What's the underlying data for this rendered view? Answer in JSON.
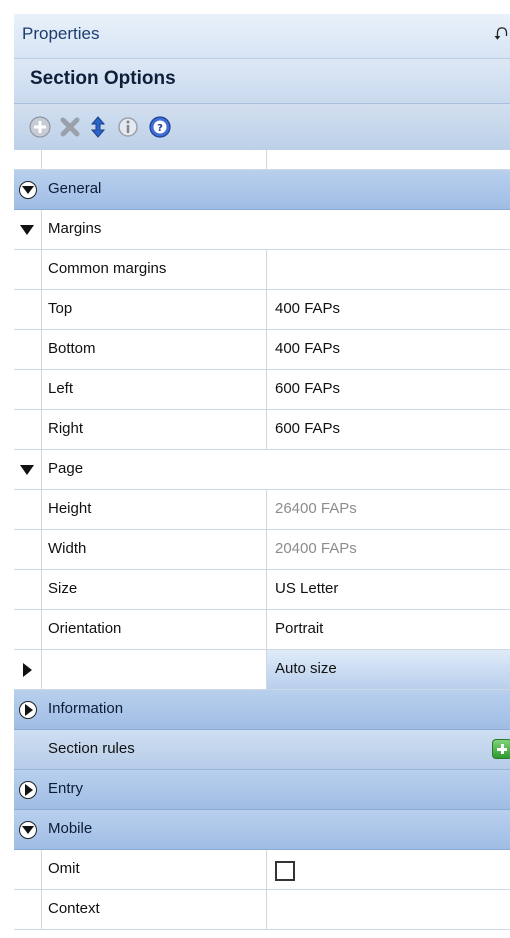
{
  "window": {
    "title": "Properties",
    "pin_glyph": "⮏"
  },
  "section": {
    "title": "Section Options"
  },
  "toolbar": {
    "buttons": [
      {
        "icon": "add-circle-icon"
      },
      {
        "icon": "delete-x-icon"
      },
      {
        "icon": "move-updown-icon"
      },
      {
        "icon": "info-icon"
      },
      {
        "icon": "help-icon"
      }
    ]
  },
  "grid": {
    "general": "General",
    "margins": "Margins",
    "common_margins": "Common margins",
    "top": {
      "label": "Top",
      "value": "400 FAPs"
    },
    "bottom": {
      "label": "Bottom",
      "value": "400 FAPs"
    },
    "left": {
      "label": "Left",
      "value": "600 FAPs"
    },
    "right": {
      "label": "Right",
      "value": "600 FAPs"
    },
    "page": "Page",
    "height": {
      "label": "Height",
      "value": "26400 FAPs"
    },
    "width": {
      "label": "Width",
      "value": "20400 FAPs"
    },
    "size": {
      "label": "Size",
      "value": "US Letter"
    },
    "orientation": {
      "label": "Orientation",
      "value": "Portrait"
    },
    "autosize": {
      "value": "Auto size"
    },
    "information": "Information",
    "section_rules": "Section rules",
    "entry": "Entry",
    "mobile": "Mobile",
    "omit": {
      "label": "Omit",
      "checked": false
    },
    "context": {
      "label": "Context",
      "value": ""
    }
  },
  "colors": {
    "category_bg": "#a9c4e8",
    "title_text": "#1c3d6e",
    "disabled_text": "#8c8c8c"
  }
}
